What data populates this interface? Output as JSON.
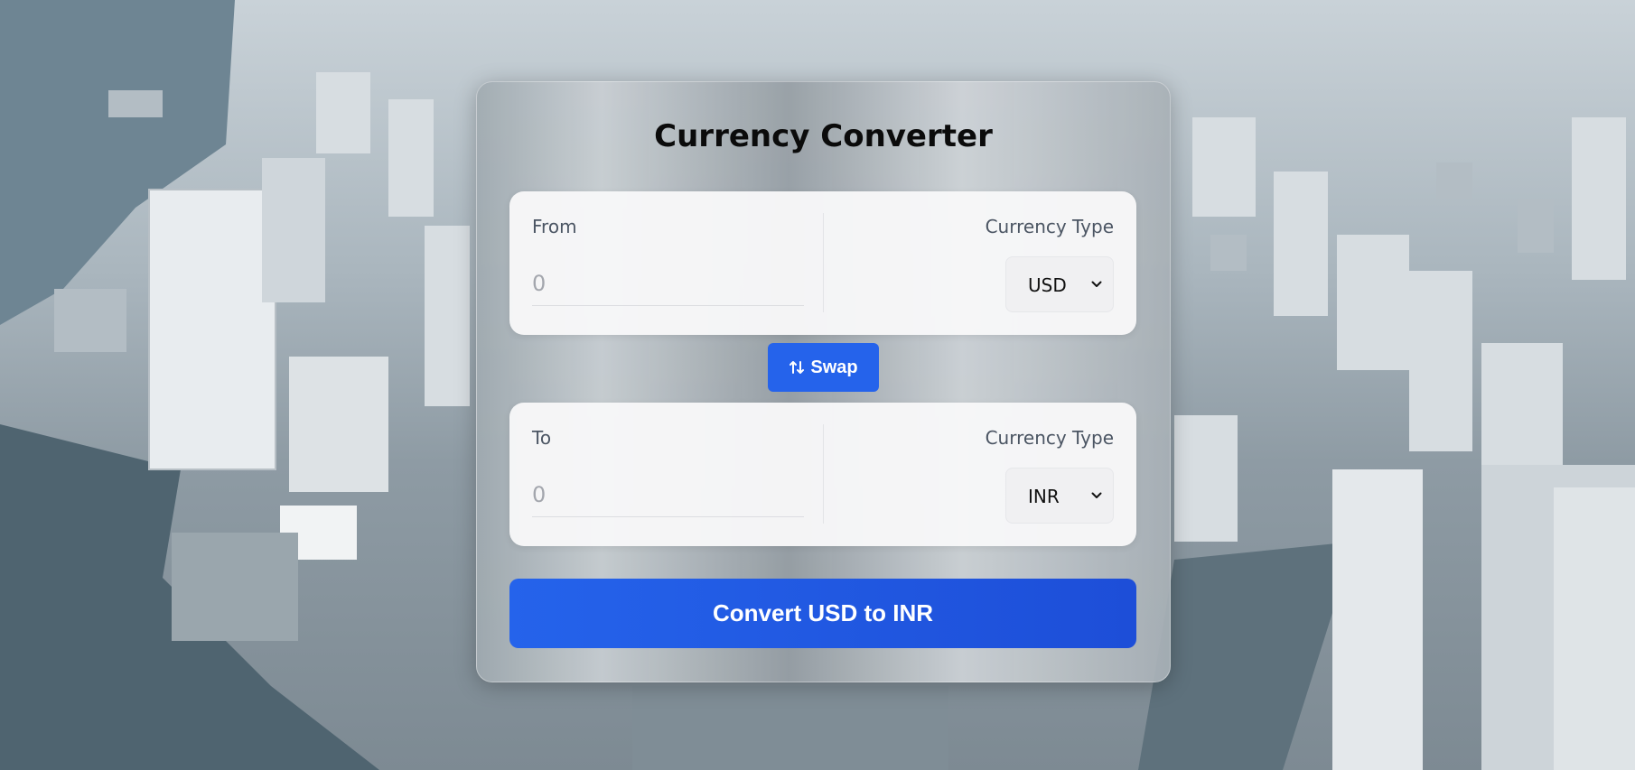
{
  "app": {
    "title": "Currency Converter"
  },
  "from": {
    "label": "From",
    "currency_label": "Currency Type",
    "amount_placeholder": "0",
    "amount_value": "",
    "currency": "USD"
  },
  "swap": {
    "label": "Swap",
    "icon": "swap-arrows-icon"
  },
  "to": {
    "label": "To",
    "currency_label": "Currency Type",
    "amount_placeholder": "0",
    "amount_value": "",
    "currency": "INR"
  },
  "convert": {
    "label": "Convert USD to INR"
  },
  "colors": {
    "accent": "#2563eb",
    "accent_dark": "#1d4ed8",
    "panel_bg": "#f7f7f8",
    "label_text": "#4b5563"
  }
}
